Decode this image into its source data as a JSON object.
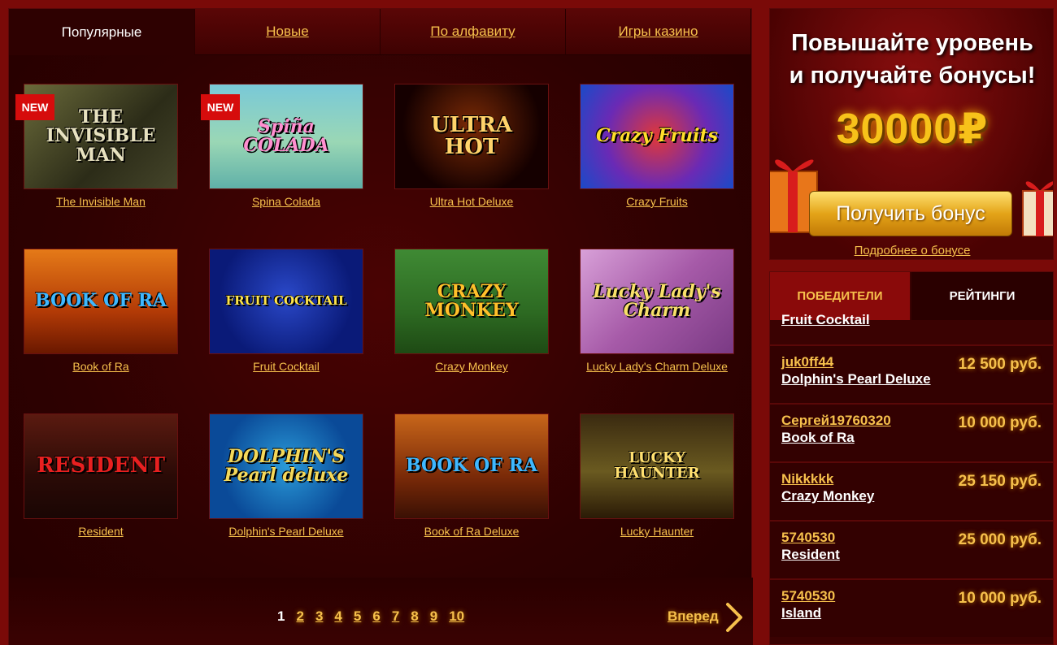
{
  "tabs": [
    {
      "label": "Популярные",
      "active": true
    },
    {
      "label": "Новые",
      "active": false
    },
    {
      "label": "По алфавиту",
      "active": false
    },
    {
      "label": "Игры казино",
      "active": false
    }
  ],
  "badge_label": "NEW",
  "games": [
    {
      "name": "The Invisible Man",
      "thumb_text": "THE INVISIBLE MAN",
      "is_new": true
    },
    {
      "name": "Spina Colada",
      "thumb_text": "Spiña COLADA",
      "is_new": true
    },
    {
      "name": "Ultra Hot Deluxe",
      "thumb_text": "ULTRA HOT",
      "is_new": false
    },
    {
      "name": "Crazy Fruits",
      "thumb_text": "Crazy Fruits",
      "is_new": false
    },
    {
      "name": "Book of Ra",
      "thumb_text": "BOOK OF RA",
      "is_new": false
    },
    {
      "name": "Fruit Cocktail",
      "thumb_text": "FRUIT COCKTAIL",
      "is_new": false
    },
    {
      "name": "Crazy Monkey",
      "thumb_text": "CRAZY MONKEY",
      "is_new": false
    },
    {
      "name": "Lucky Lady's Charm Deluxe",
      "thumb_text": "Lucky Lady's Charm",
      "is_new": false
    },
    {
      "name": "Resident",
      "thumb_text": "RESIDENT",
      "is_new": false
    },
    {
      "name": "Dolphin's Pearl Deluxe",
      "thumb_text": "DOLPHIN'S Pearl deluxe",
      "is_new": false
    },
    {
      "name": "Book of Ra Deluxe",
      "thumb_text": "BOOK OF RA",
      "is_new": false
    },
    {
      "name": "Lucky Haunter",
      "thumb_text": "LUCKY HAUNTER",
      "is_new": false
    }
  ],
  "pagination": {
    "pages": [
      "1",
      "2",
      "3",
      "4",
      "5",
      "6",
      "7",
      "8",
      "9",
      "10"
    ],
    "current": "1",
    "next_label": "Вперед"
  },
  "promo": {
    "title_line1": "Повышайте уровень",
    "title_line2": "и получайте бонусы!",
    "amount": "30000₽",
    "button_label": "Получить бонус",
    "more_link": "Подробнее о бонусе"
  },
  "winners_panel": {
    "tab_winners": "ПОБЕДИТЕЛИ",
    "tab_ratings": "РЕЙТИНГИ",
    "partial_game": "Fruit Cocktail",
    "rows": [
      {
        "user": "juk0ff44",
        "game": "Dolphin's Pearl Deluxe",
        "amount": "12 500 руб."
      },
      {
        "user": "Сергей19760320",
        "game": "Book of Ra",
        "amount": "10 000 руб."
      },
      {
        "user": "Nikkkkk",
        "game": "Crazy Monkey",
        "amount": "25 150 руб."
      },
      {
        "user": "5740530",
        "game": "Resident",
        "amount": "25 000 руб."
      },
      {
        "user": "5740530",
        "game": "Island",
        "amount": "10 000 руб."
      }
    ]
  }
}
